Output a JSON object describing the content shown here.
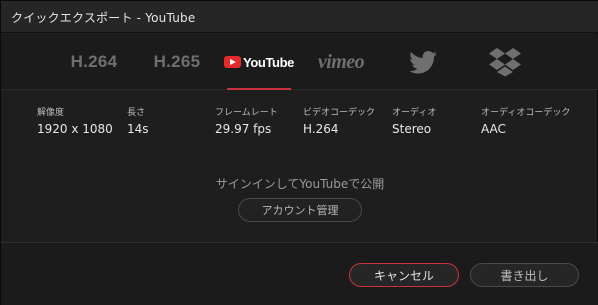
{
  "window": {
    "title": "クイックエクスポート - YouTube"
  },
  "tabs": [
    {
      "label": "H.264",
      "icon": "h264-text",
      "active": false
    },
    {
      "label": "H.265",
      "icon": "h265-text",
      "active": false
    },
    {
      "label": "YouTube",
      "icon": "youtube-logo",
      "active": true
    },
    {
      "label": "vimeo",
      "icon": "vimeo-logo",
      "active": false
    },
    {
      "label": "",
      "icon": "twitter-bird-icon",
      "active": false
    },
    {
      "label": "",
      "icon": "dropbox-icon",
      "active": false
    }
  ],
  "info": {
    "resolution": {
      "label": "解像度",
      "value": "1920 x 1080"
    },
    "length": {
      "label": "長さ",
      "value": "14s"
    },
    "framerate": {
      "label": "フレームレート",
      "value": "29.97 fps"
    },
    "video_codec": {
      "label": "ビデオコーデック",
      "value": "H.264"
    },
    "audio": {
      "label": "オーディオ",
      "value": "Stereo"
    },
    "audio_codec": {
      "label": "オーディオコーデック",
      "value": "AAC"
    }
  },
  "signin": {
    "text": "サインインしてYouTubeで公開",
    "account_button": "アカウント管理"
  },
  "footer": {
    "cancel_label": "キャンセル",
    "export_label": "書き出し"
  },
  "colors": {
    "accent": "#c8323c",
    "youtube_red": "#e52a2a",
    "inactive_icon": "#6f6f6f"
  }
}
